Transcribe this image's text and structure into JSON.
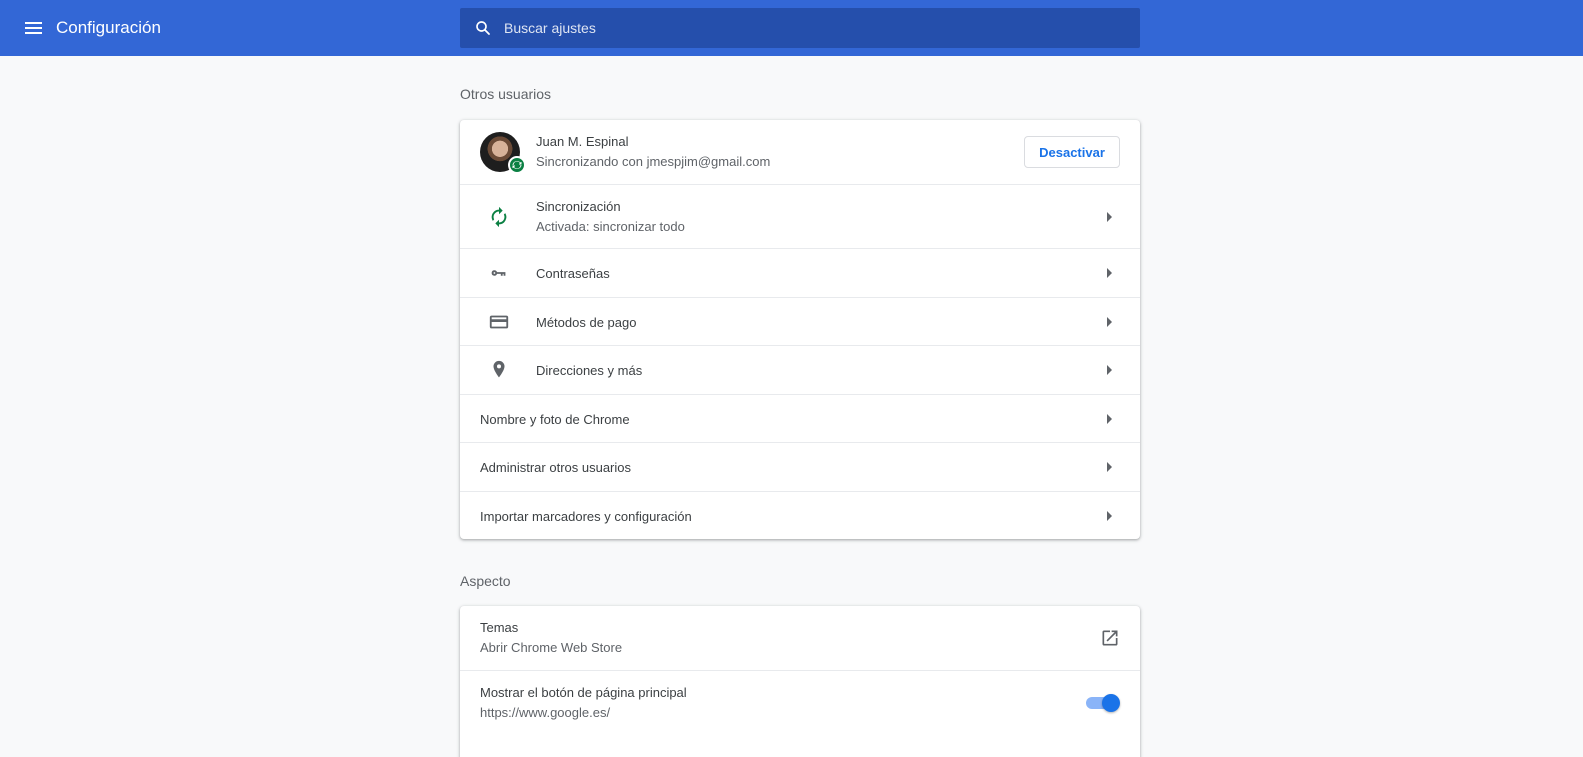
{
  "header": {
    "title": "Configuración",
    "search_placeholder": "Buscar ajustes"
  },
  "people": {
    "section_title": "Otros usuarios",
    "account": {
      "name": "Juan M. Espinal",
      "status": "Sincronizando con jmespjim@gmail.com",
      "button": "Desactivar"
    },
    "sync": {
      "label": "Sincronización",
      "sublabel": "Activada: sincronizar todo"
    },
    "passwords": {
      "label": "Contraseñas"
    },
    "payments": {
      "label": "Métodos de pago"
    },
    "addresses": {
      "label": "Direcciones y más"
    },
    "chrome_name": {
      "label": "Nombre y foto de Chrome"
    },
    "manage_users": {
      "label": "Administrar otros usuarios"
    },
    "import": {
      "label": "Importar marcadores y configuración"
    }
  },
  "appearance": {
    "section_title": "Aspecto",
    "themes": {
      "label": "Temas",
      "sublabel": "Abrir Chrome Web Store"
    },
    "home_button": {
      "label": "Mostrar el botón de página principal",
      "sublabel": "https://www.google.es/",
      "enabled": true
    }
  },
  "colors": {
    "toolbar": "#3367d6",
    "search_bg": "#254fac",
    "accent": "#1a73e8",
    "sync_green": "#0b8043"
  },
  "icons": {
    "menu": "hamburger-menu-icon",
    "search": "search-icon",
    "sync": "sync-icon",
    "key": "key-icon",
    "card": "credit-card-icon",
    "location": "location-pin-icon",
    "external": "open-in-new-icon"
  }
}
